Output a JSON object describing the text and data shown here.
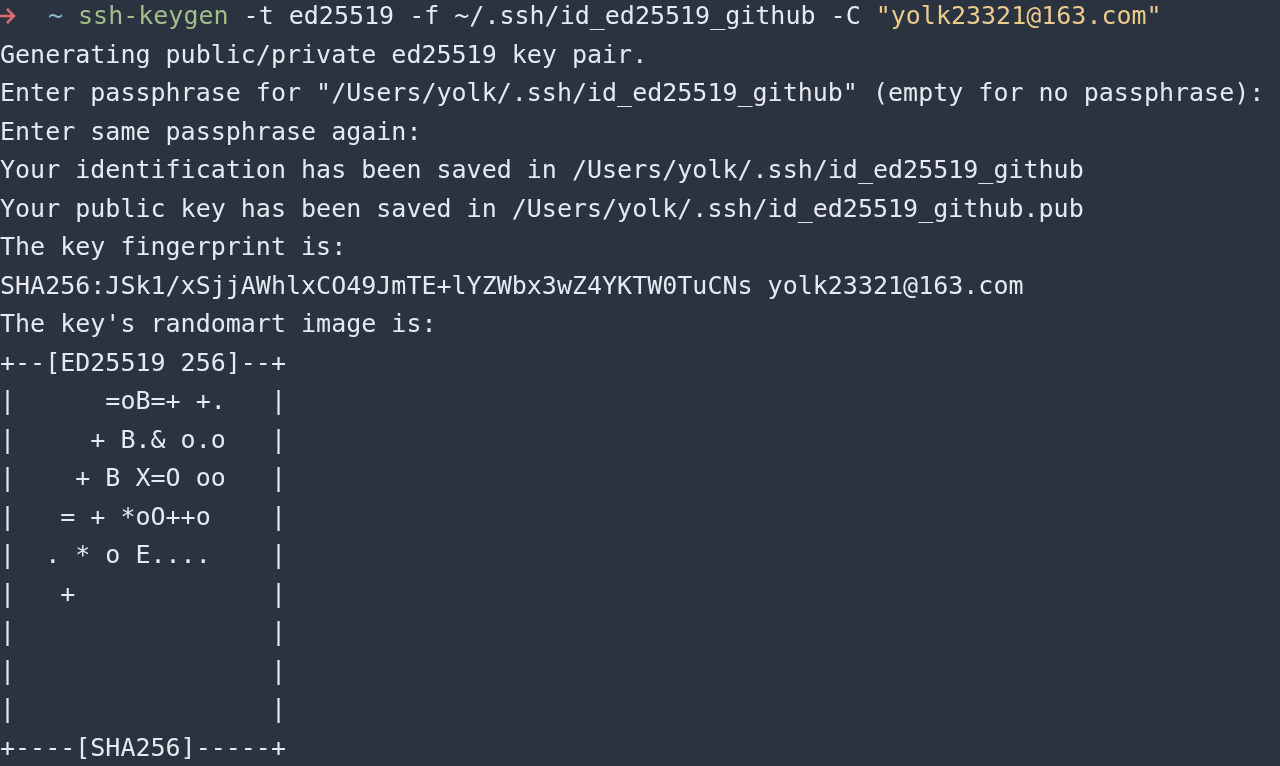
{
  "command": {
    "prompt": "~",
    "program": "ssh-keygen",
    "args": "-t ed25519 -f ~/.ssh/id_ed25519_github -C",
    "comment": "\"yolk23321@163.com\""
  },
  "output": [
    "Generating public/private ed25519 key pair.",
    "Enter passphrase for \"/Users/yolk/.ssh/id_ed25519_github\" (empty for no passphrase):",
    "Enter same passphrase again:",
    "Your identification has been saved in /Users/yolk/.ssh/id_ed25519_github",
    "Your public key has been saved in /Users/yolk/.ssh/id_ed25519_github.pub",
    "The key fingerprint is:",
    "SHA256:JSk1/xSjjAWhlxCO49JmTE+lYZWbx3wZ4YKTW0TuCNs yolk23321@163.com",
    "The key's randomart image is:",
    "+--[ED25519 256]--+",
    "|      =oB=+ +.   |",
    "|     + B.& o.o   |",
    "|    + B X=O oo   |",
    "|   = + *oO++o    |",
    "|  . * o E....    |",
    "|   +             |",
    "|                 |",
    "|                 |",
    "|                 |",
    "+----[SHA256]-----+"
  ]
}
